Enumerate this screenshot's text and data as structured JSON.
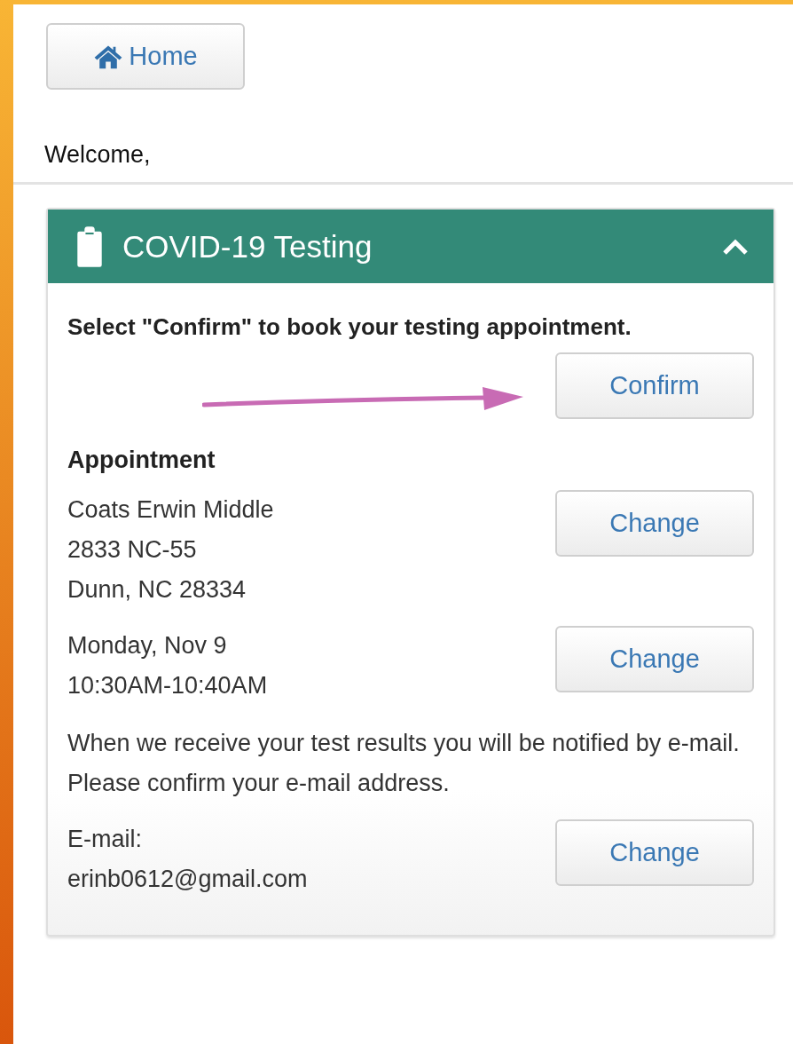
{
  "home_button": {
    "label": "Home"
  },
  "welcome": "Welcome,",
  "panel": {
    "title": "COVID-19 Testing",
    "expanded": true,
    "instruction": "Select \"Confirm\" to book your testing appointment.",
    "confirm_button": "Confirm",
    "section_title": "Appointment",
    "items": [
      {
        "kind": "detail",
        "lines": [
          "Coats Erwin Middle",
          "2833 NC-55",
          "Dunn, NC 28334"
        ],
        "button": "Change"
      },
      {
        "kind": "detail",
        "lines": [
          "Monday, Nov 9",
          "10:30AM-10:40AM"
        ],
        "button": "Change"
      },
      {
        "kind": "note",
        "text": "When we receive your test results you will be notified by e-mail. Please confirm your e-mail address."
      },
      {
        "kind": "detail",
        "lines": [
          "E-mail:",
          "erinb0612@gmail.com"
        ],
        "button": "Change"
      }
    ]
  }
}
